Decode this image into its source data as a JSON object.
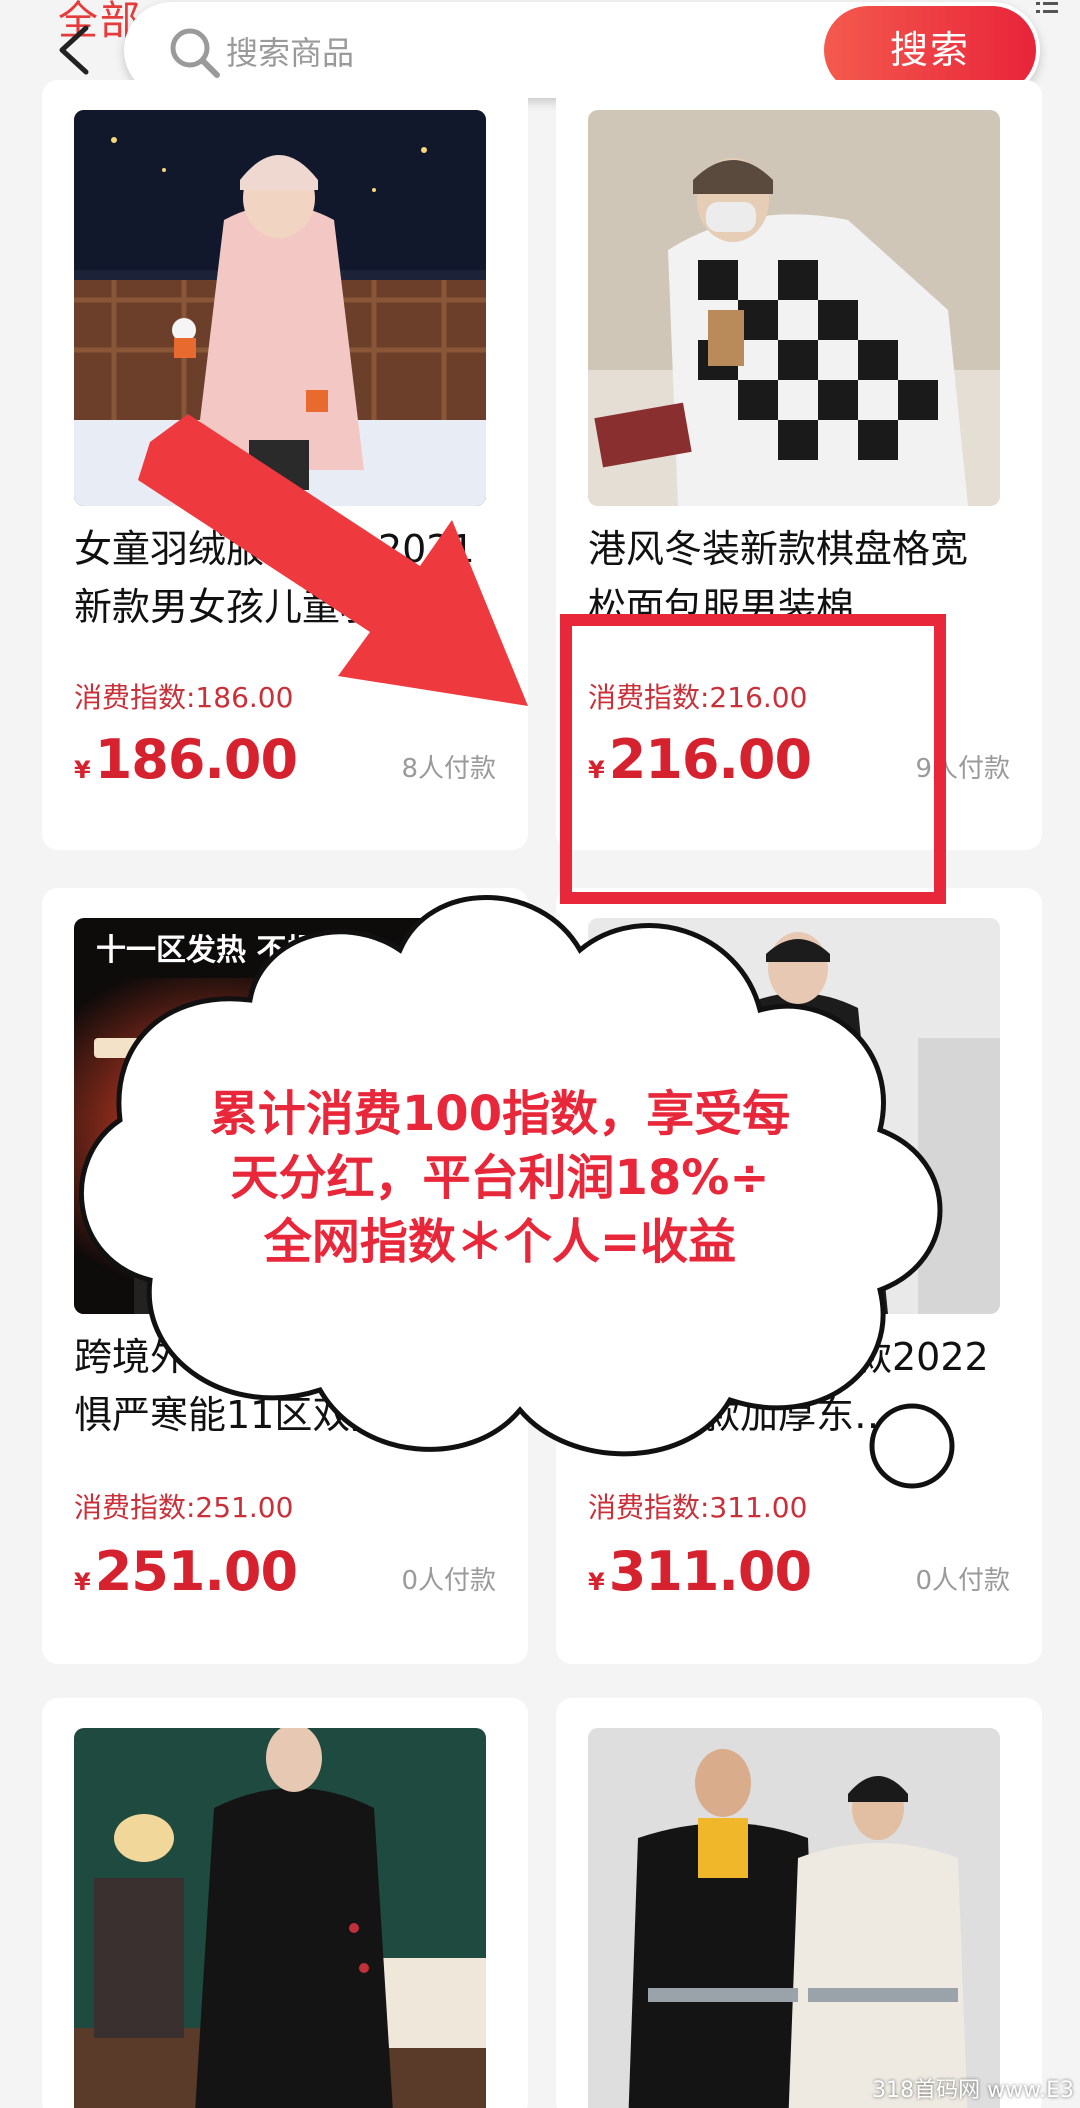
{
  "header": {
    "tab_all": "全部",
    "search_placeholder": "搜索商品",
    "search_button": "搜索"
  },
  "products": [
    {
      "title": "女童羽绒服中长款2021新款男女孩儿童羽…",
      "index_label": "消费指数:186.00",
      "currency": "¥",
      "price": "186.00",
      "paid": "8人付款"
    },
    {
      "title": "港风冬装新款棋盘格宽松面包服男装棉…",
      "index_label": "消费指数:216.00",
      "currency": "¥",
      "price": "216.00",
      "paid": "9人付款"
    },
    {
      "title": "跨境外贸十一区发热不惧严寒能11区双拼…",
      "index_label": "消费指数:251.00",
      "currency": "¥",
      "price": "251.00",
      "paid": "0人付款"
    },
    {
      "title": "女士羽绒服中长款2022冬季新款加厚东…",
      "index_label": "消费指数:311.00",
      "currency": "¥",
      "price": "311.00",
      "paid": "0人付款"
    },
    {
      "title": "",
      "index_label": "",
      "currency": "",
      "price": "",
      "paid": ""
    },
    {
      "title": "",
      "index_label": "",
      "currency": "",
      "price": "",
      "paid": ""
    }
  ],
  "promo_image_text": "十一区发热 不惧严寒",
  "annotation": {
    "line1": "累计消费100指数，享受每",
    "line2": "天分红，平台利润18%÷",
    "line3": "全网指数＊个人=收益"
  },
  "watermark": "318首码网 www.E3",
  "colors": {
    "accent": "#e8283a",
    "price": "#d6222f",
    "background": "#f4f4f4"
  }
}
